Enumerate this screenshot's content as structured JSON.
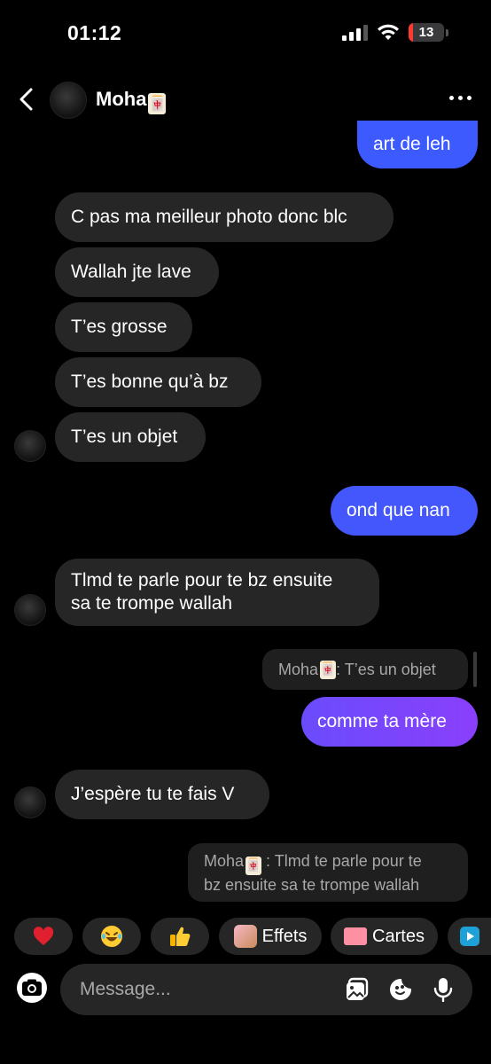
{
  "status_bar": {
    "time": "01:12",
    "battery": "13",
    "battery_level": 0.13
  },
  "header": {
    "name": "Moha",
    "name_emoji": "🀄"
  },
  "messages": [
    {
      "side": "out",
      "text": "art de leh"
    },
    {
      "side": "in",
      "text": "C pas ma meilleur photo donc blc"
    },
    {
      "side": "in",
      "text": "Wallah jte lave"
    },
    {
      "side": "in",
      "text": "T’es grosse"
    },
    {
      "side": "in",
      "text": "T’es bonne qu’à bz"
    },
    {
      "side": "in",
      "text": "T’es un objet"
    },
    {
      "side": "out",
      "text": "ond que nan"
    },
    {
      "side": "in",
      "line1": "Tlmd te parle pour te bz ensuite",
      "line2": "sa te trompe wallah"
    },
    {
      "side": "out",
      "reply_name": "Moha",
      "reply_text": " : T’es un objet",
      "text": "comme ta mère"
    },
    {
      "side": "in",
      "text": "J’espère tu te fais V"
    },
    {
      "side": "out",
      "reply_name": "Moha",
      "reply_line1": " : Tlmd te parle pour te",
      "reply_line2": "bz ensuite sa te trompe wallah"
    }
  ],
  "quick_actions": {
    "effets": "Effets",
    "cartes": "Cartes"
  },
  "composer": {
    "placeholder": "Message..."
  },
  "colors": {
    "incoming": "#262626",
    "outgoing_start": "#3d5afe",
    "outgoing_end": "#8a3ffc",
    "background": "#000000"
  }
}
